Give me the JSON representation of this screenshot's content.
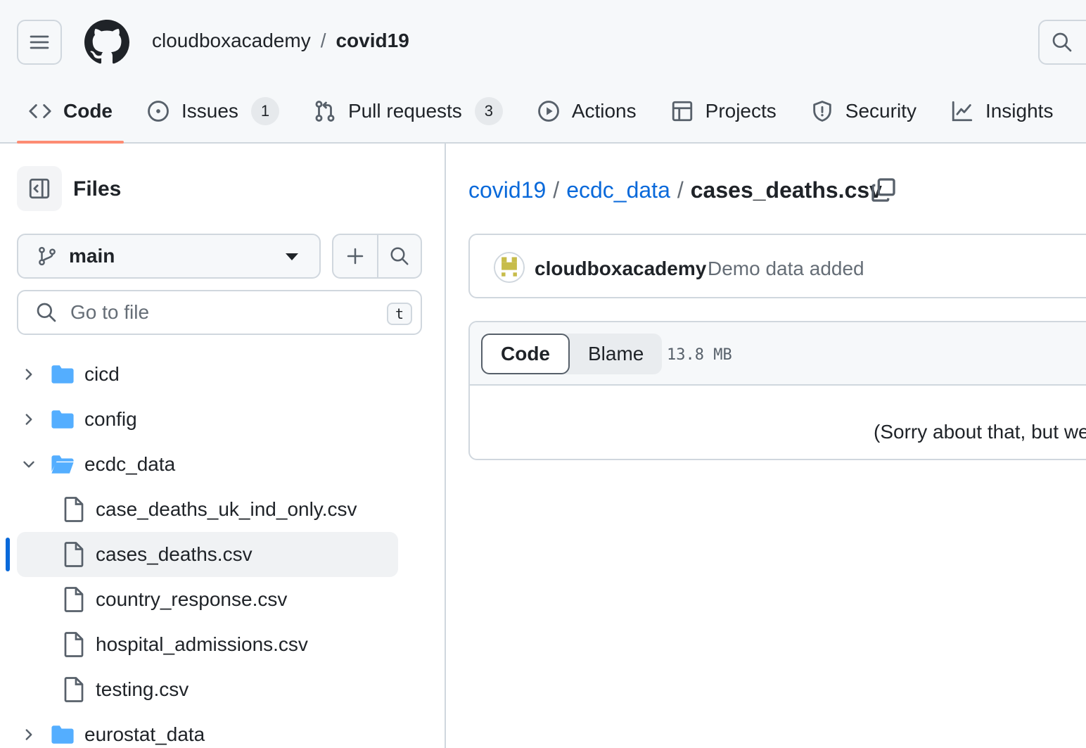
{
  "header": {
    "owner": "cloudboxacademy",
    "separator": "/",
    "repo": "covid19"
  },
  "nav": {
    "items": [
      {
        "label": "Code",
        "icon": "code-icon",
        "active": true
      },
      {
        "label": "Issues",
        "icon": "issue-opened-icon",
        "count": "1"
      },
      {
        "label": "Pull requests",
        "icon": "git-pull-request-icon",
        "count": "3"
      },
      {
        "label": "Actions",
        "icon": "play-icon"
      },
      {
        "label": "Projects",
        "icon": "table-icon"
      },
      {
        "label": "Security",
        "icon": "shield-icon"
      },
      {
        "label": "Insights",
        "icon": "graph-icon"
      }
    ]
  },
  "sidebar": {
    "title": "Files",
    "branch": "main",
    "goto_placeholder": "Go to file",
    "goto_shortcut": "t",
    "tree": [
      {
        "type": "folder",
        "name": "cicd",
        "expanded": false
      },
      {
        "type": "folder",
        "name": "config",
        "expanded": false
      },
      {
        "type": "folder",
        "name": "ecdc_data",
        "expanded": true
      },
      {
        "type": "file",
        "name": "case_deaths_uk_ind_only.csv"
      },
      {
        "type": "file",
        "name": "cases_deaths.csv",
        "selected": true
      },
      {
        "type": "file",
        "name": "country_response.csv"
      },
      {
        "type": "file",
        "name": "hospital_admissions.csv"
      },
      {
        "type": "file",
        "name": "testing.csv"
      },
      {
        "type": "folder",
        "name": "eurostat_data",
        "expanded": false
      }
    ]
  },
  "breadcrumb": {
    "root": "covid19",
    "folder": "ecdc_data",
    "file": "cases_deaths.csv",
    "sep": "/"
  },
  "commit": {
    "author": "cloudboxacademy",
    "message": "Demo data added"
  },
  "file_view": {
    "tab_code": "Code",
    "tab_blame": "Blame",
    "size": "13.8 MB",
    "message": "(Sorry about that, but we"
  },
  "colors": {
    "accent_link": "#0969da",
    "nav_underline": "#fd8c73",
    "folder": "#54aeff"
  }
}
